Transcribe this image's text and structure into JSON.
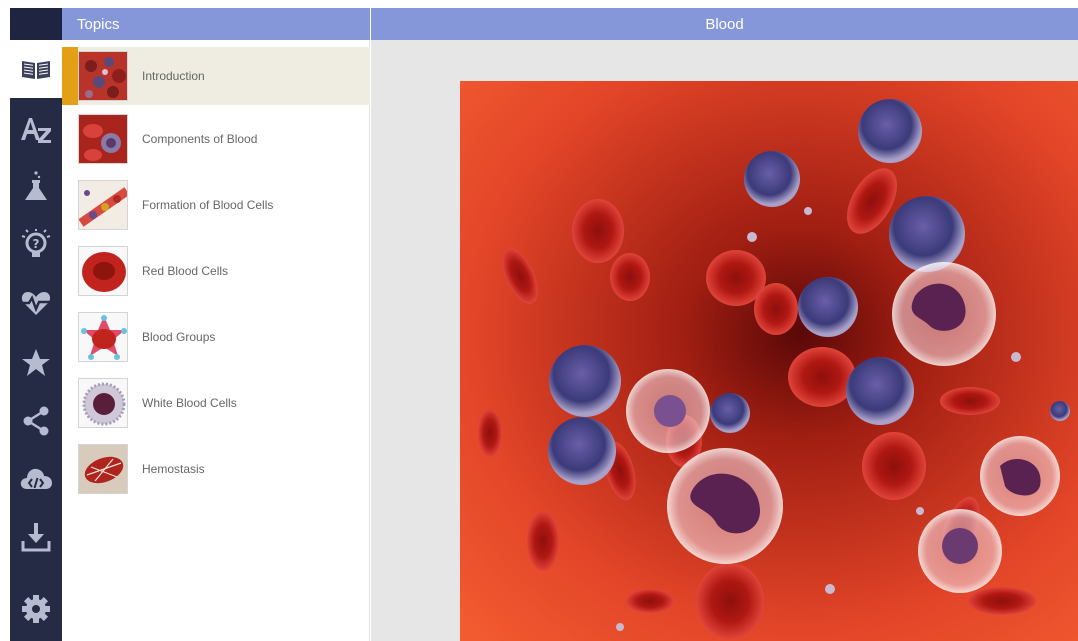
{
  "sidebar": {
    "icons": [
      "book-open-icon",
      "az-glossary-icon",
      "flask-icon",
      "lightbulb-question-icon",
      "heartbeat-icon",
      "star-icon",
      "share-icon",
      "cloud-code-icon",
      "download-icon",
      "gear-icon"
    ],
    "active_index": 0
  },
  "topics": {
    "header": "Topics",
    "items": [
      {
        "label": "Introduction"
      },
      {
        "label": "Components of Blood"
      },
      {
        "label": "Formation of Blood Cells"
      },
      {
        "label": "Red Blood Cells"
      },
      {
        "label": "Blood Groups"
      },
      {
        "label": "White Blood Cells"
      },
      {
        "label": "Hemostasis"
      }
    ],
    "active_index": 0
  },
  "main": {
    "title": "Blood"
  },
  "colors": {
    "header_bg": "#8597d8",
    "rail_bg": "#262b45",
    "active_marker": "#e2a017",
    "active_row": "#efede2"
  }
}
